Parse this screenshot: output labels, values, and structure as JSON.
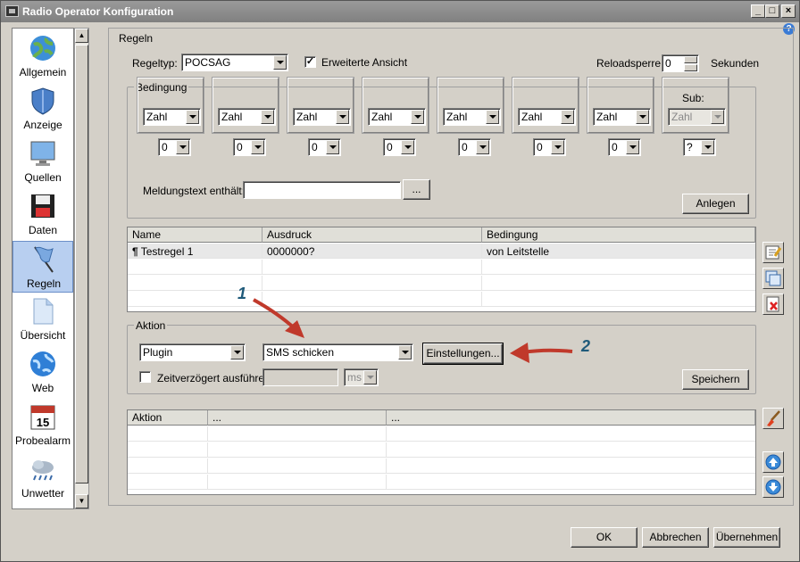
{
  "window": {
    "title": "Radio Operator Konfiguration"
  },
  "sidebar": {
    "items": [
      {
        "label": "Allgemein",
        "icon": "globe-icon"
      },
      {
        "label": "Anzeige",
        "icon": "shield-icon"
      },
      {
        "label": "Quellen",
        "icon": "monitor-icon"
      },
      {
        "label": "Daten",
        "icon": "floppy-disk-icon"
      },
      {
        "label": "Regeln",
        "icon": "flag-icon",
        "selected": true
      },
      {
        "label": "Übersicht",
        "icon": "document-icon"
      },
      {
        "label": "Web",
        "icon": "web-globe-icon"
      },
      {
        "label": "Probealarm",
        "icon": "calendar-icon"
      },
      {
        "label": "Unwetter",
        "icon": "weather-icon"
      }
    ]
  },
  "regeln": {
    "legend": "Regeln",
    "regeltyp_label": "Regeltyp:",
    "regeltyp_value": "POCSAG",
    "erweiterte_label": "Erweiterte Ansicht",
    "erweiterte_checked": true,
    "reload_label": "Reloadsperre:",
    "reload_value": "0",
    "reload_unit": "Sekunden"
  },
  "bedingung": {
    "legend": "Bedingung",
    "sub_label": "Sub:",
    "type_values": [
      "Zahl",
      "Zahl",
      "Zahl",
      "Zahl",
      "Zahl",
      "Zahl",
      "Zahl",
      "Zahl"
    ],
    "digit_values": [
      "0",
      "0",
      "0",
      "0",
      "0",
      "0",
      "0",
      "?"
    ],
    "meldung_label": "Meldungstext enthält:",
    "meldung_value": "",
    "browse_label": "...",
    "anlegen_label": "Anlegen"
  },
  "rules_table": {
    "headers": [
      "Name",
      "Ausdruck",
      "Bedingung"
    ],
    "rows": [
      {
        "name": "Testregel 1",
        "ausdruck": "0000000?",
        "bedingung": "von Leitstelle"
      }
    ]
  },
  "aktion": {
    "legend": "Aktion",
    "type_value": "Plugin",
    "action_value": "SMS schicken",
    "settings_label": "Einstellungen...",
    "delay_label": "Zeitverzögert ausführen",
    "delay_checked": false,
    "delay_value": "",
    "unit_value": "ms",
    "save_label": "Speichern"
  },
  "action_table": {
    "headers": [
      "Aktion",
      "...",
      "..."
    ]
  },
  "annotations": {
    "one": "1",
    "two": "2",
    "arrow_color": "#c0392b"
  },
  "footer": {
    "ok": "OK",
    "cancel": "Abbrechen",
    "apply": "Übernehmen"
  }
}
